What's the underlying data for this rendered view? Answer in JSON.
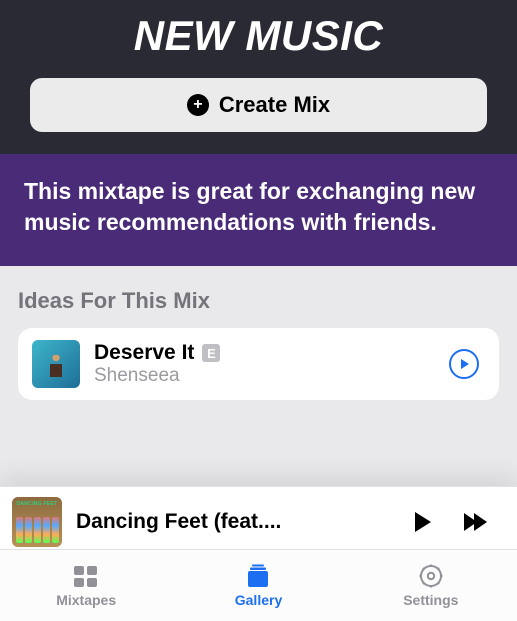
{
  "header": {
    "title": "NEW MUSIC",
    "create_label": "Create Mix"
  },
  "description": "This mixtape is great for exchanging new music recommendations with friends.",
  "ideas": {
    "heading": "Ideas For This Mix",
    "items": [
      {
        "title": "Deserve It",
        "explicit": "E",
        "artist": "Shenseea"
      }
    ]
  },
  "now_playing": {
    "title": "Dancing Feet (feat....",
    "cover_label": "DANCING FEET"
  },
  "tabs": {
    "mixtapes": "Mixtapes",
    "gallery": "Gallery",
    "settings": "Settings",
    "active": "gallery"
  }
}
